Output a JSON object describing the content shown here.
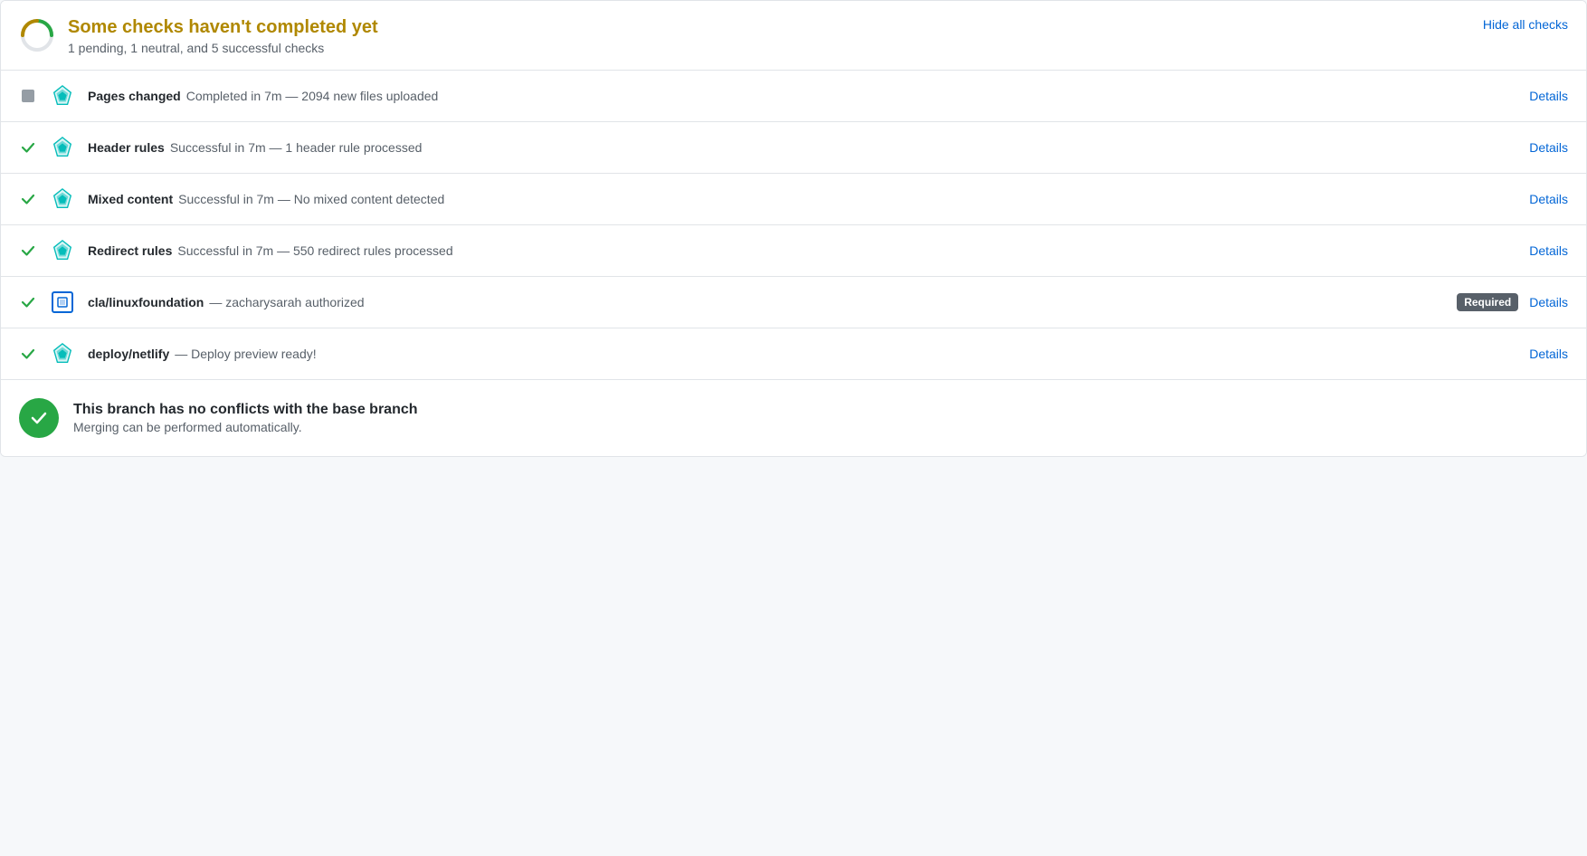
{
  "header": {
    "title": "Some checks haven't completed yet",
    "subtitle": "1 pending, 1 neutral, and 5 successful checks",
    "hide_all_label": "Hide all checks",
    "spinner_color_outer": "#28a745",
    "spinner_color_inner": "#b08800"
  },
  "checks": [
    {
      "id": "pages-changed",
      "status": "neutral",
      "name": "Pages changed",
      "description": "Completed in 7m — 2094 new files uploaded",
      "required": false,
      "details_label": "Details",
      "icon_type": "netlify"
    },
    {
      "id": "header-rules",
      "status": "success",
      "name": "Header rules",
      "description": "Successful in 7m — 1 header rule processed",
      "required": false,
      "details_label": "Details",
      "icon_type": "netlify"
    },
    {
      "id": "mixed-content",
      "status": "success",
      "name": "Mixed content",
      "description": "Successful in 7m — No mixed content detected",
      "required": false,
      "details_label": "Details",
      "icon_type": "netlify"
    },
    {
      "id": "redirect-rules",
      "status": "success",
      "name": "Redirect rules",
      "description": "Successful in 7m — 550 redirect rules processed",
      "required": false,
      "details_label": "Details",
      "icon_type": "netlify"
    },
    {
      "id": "cla-linuxfoundation",
      "status": "success",
      "name": "cla/linuxfoundation",
      "description": "— zacharysarah authorized",
      "required": true,
      "required_label": "Required",
      "details_label": "Details",
      "icon_type": "cla"
    },
    {
      "id": "deploy-netlify",
      "status": "success",
      "name": "deploy/netlify",
      "description": "— Deploy preview ready!",
      "required": false,
      "details_label": "Details",
      "icon_type": "netlify"
    }
  ],
  "merge": {
    "title": "This branch has no conflicts with the base branch",
    "subtitle": "Merging can be performed automatically."
  }
}
